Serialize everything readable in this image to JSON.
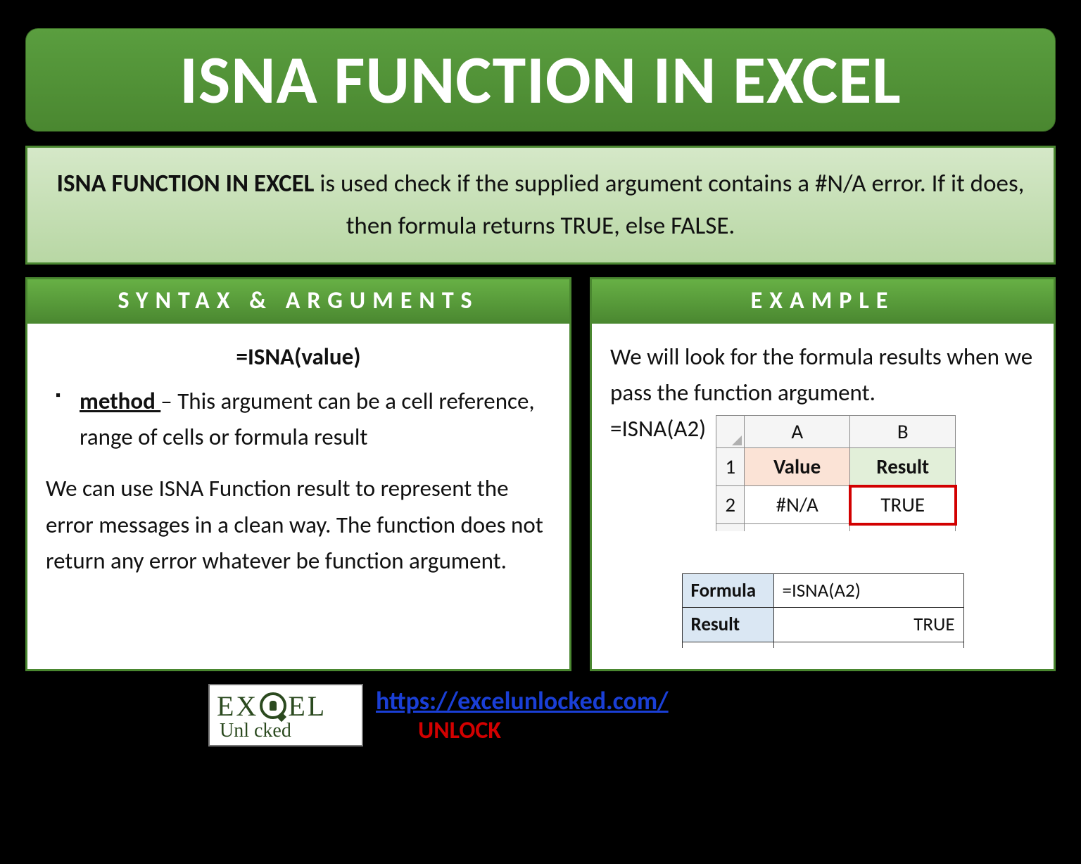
{
  "title": "ISNA FUNCTION IN EXCEL",
  "description": {
    "bold": "ISNA FUNCTION IN EXCEL",
    "rest": " is used check if the supplied argument contains a #N/A error. If it does, then formula returns TRUE, else FALSE."
  },
  "syntax": {
    "header": "SYNTAX & ARGUMENTS",
    "formula": "=ISNA(value)",
    "arg_name": "method ",
    "arg_desc": "– This argument can be a cell reference, range of cells or formula result",
    "note": "We can use ISNA Function result to represent the error messages in a clean way. The function does not return any error whatever be function argument."
  },
  "example": {
    "header": "EXAMPLE",
    "intro": "We will look for the formula results when we pass the function argument.",
    "formula_used": "=ISNA(A2)",
    "grid": {
      "colA": "A",
      "colB": "B",
      "row1": "1",
      "row2": "2",
      "hdr_value": "Value",
      "hdr_result": "Result",
      "cell_a2": "#N/A",
      "cell_b2": "TRUE"
    },
    "formula_table": {
      "formula_label": "Formula",
      "formula_value": "=ISNA(A2)",
      "result_label": "Result",
      "result_value": "TRUE"
    }
  },
  "footer": {
    "logo_top_1": "EX",
    "logo_top_2": "EL",
    "logo_bottom": "Unl   cked",
    "url": "https://excelunlocked.com/",
    "unlock": "UNLOCK"
  }
}
